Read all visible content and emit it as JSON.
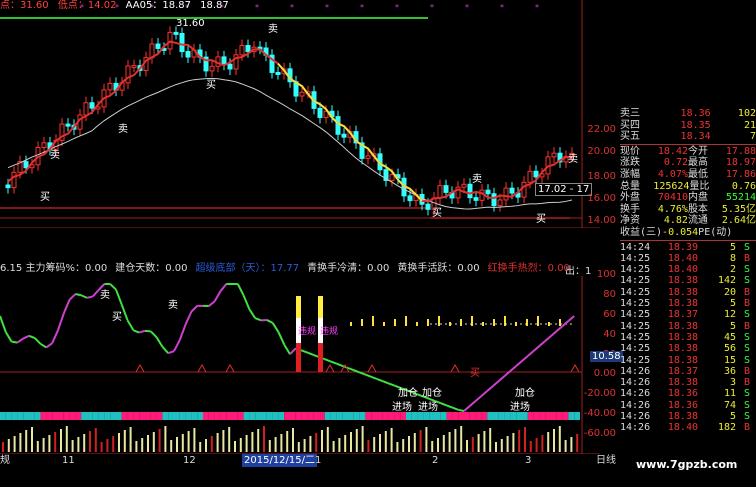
{
  "header": {
    "high_label": "点：31.60",
    "low_label": "低点：14.02",
    "aa05_label": "AA05：18.87",
    "aa05_extra": "18.87",
    "peak_annotation": "31.60",
    "level_box": "17.02 - 17"
  },
  "chart_signals": {
    "buy": "买",
    "sell": "卖",
    "add_position": "加仓",
    "enter": "进场",
    "out": "出：",
    "violation": "违规"
  },
  "main_axis": [
    "22.00",
    "20.00",
    "18.00",
    "16.00",
    "14.00"
  ],
  "ind_axis": [
    "100",
    "80",
    "60",
    "40",
    "20",
    "0.00",
    "-20.00",
    "-40.00",
    "-60.00"
  ],
  "ind_axis_badge": "10.58",
  "indicator_bar": [
    {
      "text": "6.15 主力筹码%：0.00",
      "color": "#dddddd"
    },
    {
      "text": "建仓天数：0.00",
      "color": "#dddddd"
    },
    {
      "text": "超级底部（天）：17.77",
      "color": "#2a5bd7"
    },
    {
      "text": "青换手冷清：0.00",
      "color": "#dddddd"
    },
    {
      "text": "黄换手活跃：0.00",
      "color": "#dddddd"
    },
    {
      "text": "红换手热烈：0.00",
      "color": "#e03030"
    }
  ],
  "indicator_out": "出：1",
  "quote_panel": {
    "order_book": [
      {
        "label": "卖三",
        "price": "18.36",
        "vol": "102"
      },
      {
        "label": "买四",
        "price": "18.35",
        "vol": "21"
      },
      {
        "label": "买五",
        "price": "18.34",
        "vol": "7"
      }
    ],
    "stats": [
      [
        "现价",
        "18.42",
        "今开",
        "17.88"
      ],
      [
        "涨跌",
        "0.72",
        "最高",
        "18.97"
      ],
      [
        "涨幅",
        "4.07%",
        "最低",
        "17.86"
      ],
      [
        "总量",
        "125624",
        "量比",
        "0.76"
      ],
      [
        "外盘",
        "70410",
        "内盘",
        "55214"
      ],
      [
        "换手",
        "4.76%",
        "股本",
        "5.35亿"
      ],
      [
        "净资",
        "4.82",
        "流通",
        "2.64亿"
      ],
      [
        "收益(三)",
        "-0.054",
        "PE(动)",
        ""
      ]
    ]
  },
  "ticks": [
    [
      "14:24",
      "18.39",
      "5",
      "S"
    ],
    [
      "14:25",
      "18.40",
      "8",
      "B"
    ],
    [
      "14:25",
      "18.40",
      "2",
      "S"
    ],
    [
      "14:25",
      "18.38",
      "142",
      "S"
    ],
    [
      "14:25",
      "18.38",
      "20",
      "B"
    ],
    [
      "14:25",
      "18.38",
      "5",
      "B"
    ],
    [
      "14:25",
      "18.37",
      "12",
      "S"
    ],
    [
      "14:25",
      "18.38",
      "5",
      "B"
    ],
    [
      "14:25",
      "18.38",
      "45",
      "S"
    ],
    [
      "14:25",
      "18.38",
      "56",
      "S"
    ],
    [
      "14:25",
      "18.38",
      "15",
      "S"
    ],
    [
      "14:26",
      "18.37",
      "36",
      "B"
    ],
    [
      "14:26",
      "18.38",
      "3",
      "B"
    ],
    [
      "14:26",
      "18.36",
      "11",
      "S"
    ],
    [
      "14:26",
      "18.36",
      "74",
      "S"
    ],
    [
      "14:26",
      "18.38",
      "5",
      "S"
    ],
    [
      "14:26",
      "18.40",
      "182",
      "B"
    ]
  ],
  "date_bar": {
    "left_label": "规",
    "months": [
      "11",
      "12",
      "1",
      "2",
      "3"
    ],
    "cursor_date": "2015/12/15/二",
    "right_label": "日线"
  },
  "watermark": "www.7gpzb.com",
  "colors": {
    "up": "#ff3030",
    "down": "#33ffff",
    "ma_red": "#e03030",
    "ma_yellow": "#f0e040",
    "ma_white": "#cccccc",
    "buy_color": "#ffffff",
    "sell_color": "#ffffff",
    "magenta": "#d040d0",
    "green": "#40e040"
  }
}
